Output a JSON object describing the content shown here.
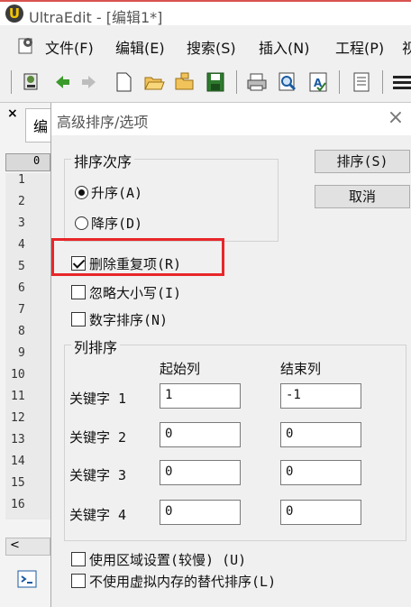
{
  "app": {
    "title": "UltraEdit - [编辑1*]",
    "logo_letter": "U"
  },
  "menu": [
    "文件(F)",
    "编辑(E)",
    "搜索(S)",
    "插入(N)",
    "工程(P)",
    "视"
  ],
  "editor": {
    "close_glyph": "×",
    "tab_stub": "编",
    "ruler_stub": "0",
    "line_numbers": [
      "1",
      "2",
      "3",
      "4",
      "5",
      "6",
      "7",
      "8",
      "9",
      "10",
      "11",
      "12",
      "13",
      "14",
      "15",
      "16"
    ],
    "scroll_left": "<"
  },
  "dialog": {
    "title": "高级排序/选项",
    "close": "×",
    "sort_order": {
      "label": "排序次序",
      "ascending": {
        "label": "升序(A)",
        "selected": true
      },
      "descending": {
        "label": "降序(D)",
        "selected": false
      }
    },
    "buttons": {
      "sort": "排序(S)",
      "cancel": "取消"
    },
    "options": {
      "remove_duplicates": {
        "label": "删除重复项(R)",
        "checked": true
      },
      "ignore_case": {
        "label": "忽略大小写(I)",
        "checked": false
      },
      "numeric_sort": {
        "label": "数字排序(N)",
        "checked": false
      },
      "use_locale": {
        "label": "使用区域设置(较慢) (U)",
        "checked": false
      },
      "no_virtual_memory": {
        "label": "不使用虚拟内存的替代排序(L)",
        "checked": false
      }
    },
    "column_sort": {
      "label": "列排序",
      "start_col_header": "起始列",
      "end_col_header": "结束列",
      "keys": [
        {
          "label": "关键字 1",
          "start": "1",
          "end": "-1"
        },
        {
          "label": "关键字 2",
          "start": "0",
          "end": "0"
        },
        {
          "label": "关键字 3",
          "start": "0",
          "end": "0"
        },
        {
          "label": "关键字 4",
          "start": "0",
          "end": "0"
        }
      ]
    }
  },
  "colors": {
    "highlight": "#e8262a",
    "title_accent": "#d9534f"
  }
}
